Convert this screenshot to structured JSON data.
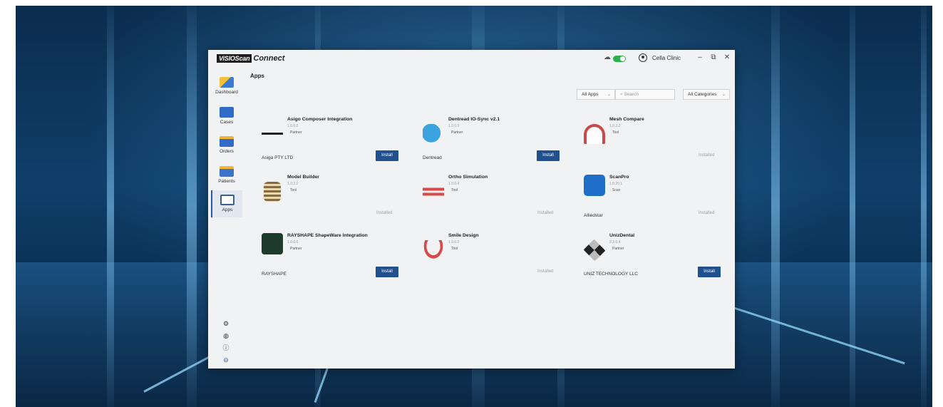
{
  "app": {
    "brand": "ViSIOScan",
    "product": "Connect"
  },
  "titlebar": {
    "user": "Cella Clinic",
    "minimize": "–",
    "restore": "⧉",
    "close": "✕"
  },
  "sidebar": {
    "items": [
      {
        "label": "Dashboard",
        "icon": "dashboard-icon"
      },
      {
        "label": "Cases",
        "icon": "folder-icon"
      },
      {
        "label": "Orders",
        "icon": "orders-icon"
      },
      {
        "label": "Patients",
        "icon": "patients-icon"
      },
      {
        "label": "Apps",
        "icon": "apps-icon",
        "active": true
      }
    ],
    "bottom": [
      "settings-icon",
      "globe-icon",
      "info-icon",
      "logout-icon"
    ]
  },
  "main": {
    "title": "Apps",
    "filter": "All Apps",
    "search_placeholder": "Search",
    "category": "All Categories"
  },
  "apps": [
    {
      "name": "Asigo Composer Integration",
      "version": "1.0.0.0",
      "tag": "Partner",
      "vendor": "Asiga PTY LTD",
      "status": "Install"
    },
    {
      "name": "Dentread IO-Sync v2.1",
      "version": "1.0.0.0",
      "tag": "Partner",
      "vendor": "Dentread",
      "status": "Install"
    },
    {
      "name": "Mesh Compare",
      "version": "1.0.2.2",
      "tag": "Tool",
      "vendor": "",
      "status": "Installed"
    },
    {
      "name": "Model Builder",
      "version": "1.0.2.2",
      "tag": "Tool",
      "vendor": "",
      "status": "Installed"
    },
    {
      "name": "Ortho Simulation",
      "version": "1.0.0.4",
      "tag": "Tool",
      "vendor": "",
      "status": "Installed"
    },
    {
      "name": "ScanPro",
      "version": "1.0.20.1",
      "tag": "Scan",
      "vendor": "Alliedstar",
      "status": "Installed"
    },
    {
      "name": "RAYSHAPE ShapeWare Integration",
      "version": "1.0.0.0",
      "tag": "Partner",
      "vendor": "RAYSHAPE",
      "status": "Install"
    },
    {
      "name": "Smile Design",
      "version": "1.0.0.2",
      "tag": "Tool",
      "vendor": "",
      "status": "Installed"
    },
    {
      "name": "UnizDental",
      "version": "2.2.0.4",
      "tag": "Partner",
      "vendor": "UNIZ TECHNOLOGY LLC",
      "status": "Install"
    }
  ],
  "colors": {
    "accent": "#21508f",
    "toggle_on": "#2bb24c"
  }
}
